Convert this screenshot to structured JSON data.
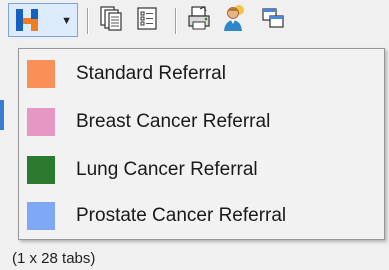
{
  "toolbar": {
    "icons": [
      "referral-split-icon",
      "chevron-down-icon",
      "documents-icon",
      "checklist-icon",
      "printer-icon",
      "user-icon",
      "windows-icon"
    ]
  },
  "menu": {
    "items": [
      {
        "label": "Standard Referral",
        "color": "#f99058"
      },
      {
        "label": "Breast Cancer Referral",
        "color": "#e697c3"
      },
      {
        "label": "Lung Cancer Referral",
        "color": "#2c7a2f"
      },
      {
        "label": "Prostate Cancer Referral",
        "color": "#7fa8f5"
      }
    ]
  },
  "status": {
    "text": "(1 x 28 tabs)"
  }
}
